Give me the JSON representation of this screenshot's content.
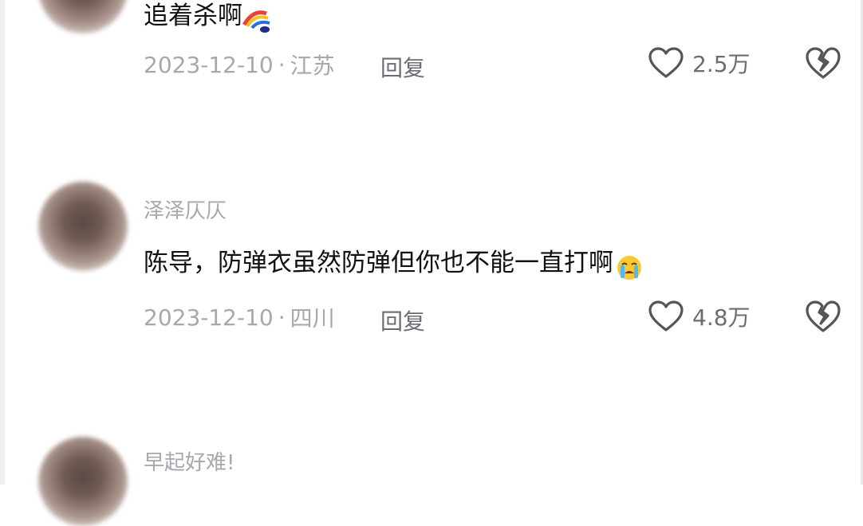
{
  "comments": [
    {
      "username": "",
      "text": "追着杀啊",
      "date": "2023-12-10",
      "separator": "·",
      "location": "江苏",
      "reply_label": "回复",
      "likes": "2.5万",
      "emoji": "cartoon-sticker"
    },
    {
      "username": "泽泽仄仄",
      "text": "陈导，防弹衣虽然防弹但你也不能一直打啊",
      "date": "2023-12-10",
      "separator": "·",
      "location": "四川",
      "reply_label": "回复",
      "likes": "4.8万",
      "emoji": "crying-face"
    },
    {
      "username": "早起好难!",
      "text": "",
      "date": "",
      "location": "",
      "reply_label": "",
      "likes": ""
    }
  ],
  "colors": {
    "meta_text": "#a7a7ad",
    "comment_text": "#111111",
    "icon_stroke": "#555555"
  }
}
